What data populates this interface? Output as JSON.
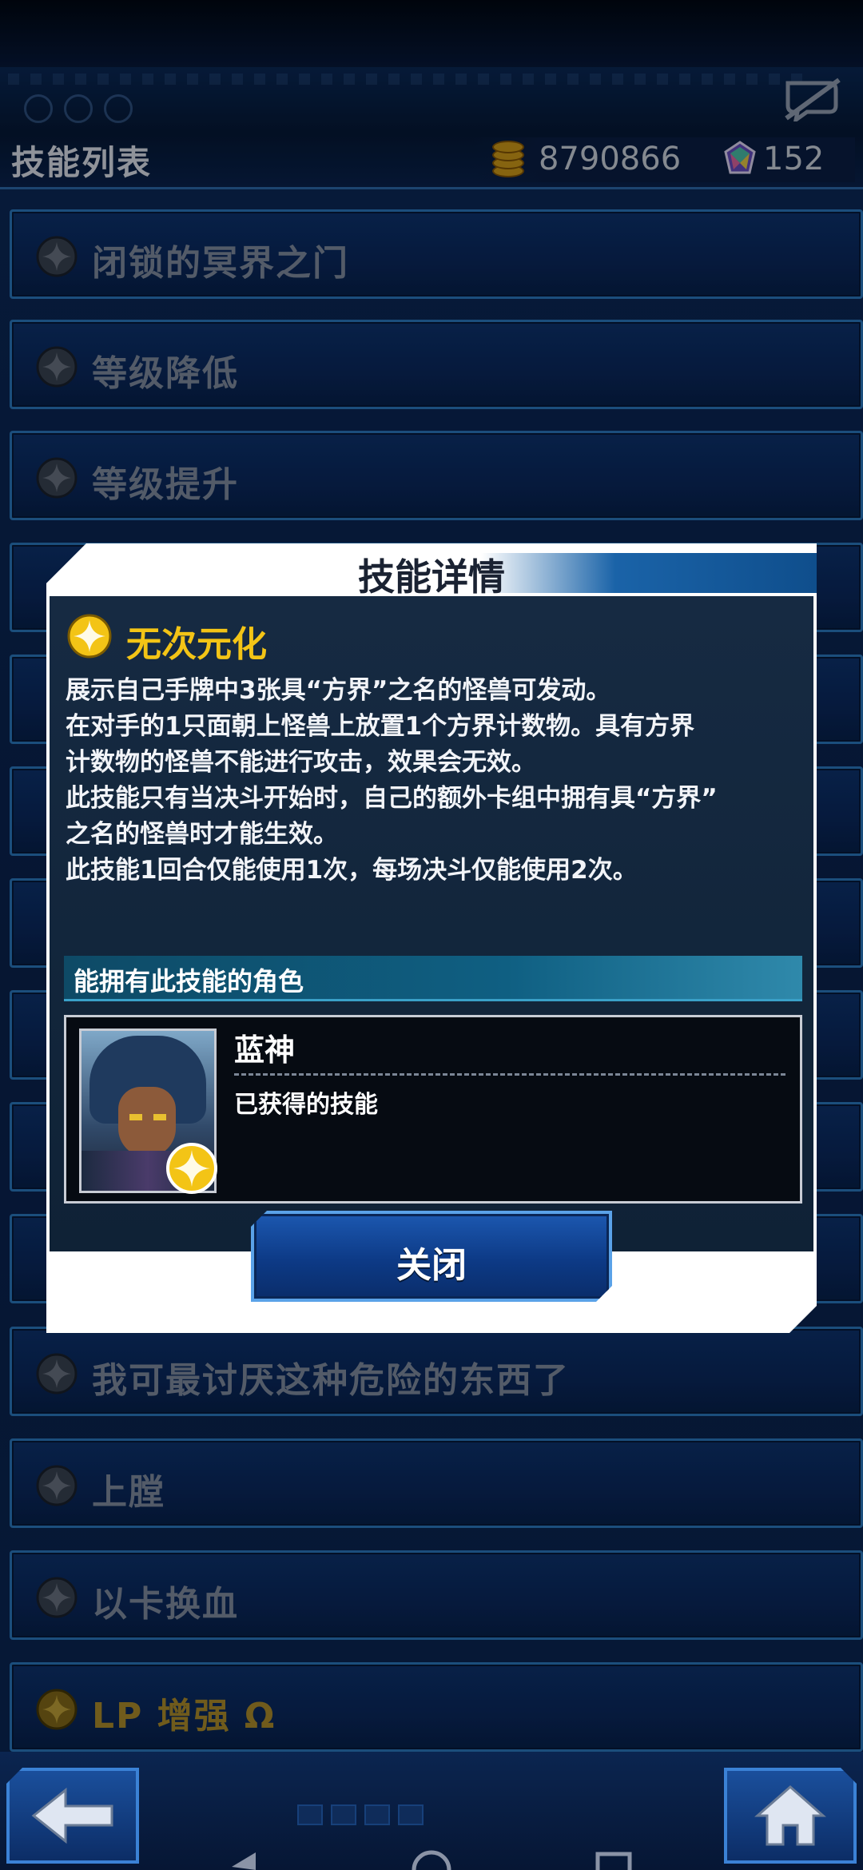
{
  "header": {
    "title": "技能列表",
    "coins": "8790866",
    "gems": "152"
  },
  "skills": [
    {
      "name": "闭锁的冥界之门",
      "badge": "gray"
    },
    {
      "name": "等级降低",
      "badge": "gray"
    },
    {
      "name": "等级提升",
      "badge": "gray"
    },
    {
      "name": "我可最讨厌这种危险的东西了",
      "badge": "gray"
    },
    {
      "name": "上膛",
      "badge": "gray"
    },
    {
      "name": "以卡换血",
      "badge": "gray"
    },
    {
      "name": "LP 增强 Ω",
      "badge": "gold"
    }
  ],
  "modal": {
    "title": "技能详情",
    "skill_name": "无次元化",
    "description": [
      "展示自己手牌中3张具“方界”之名的怪兽可发动。",
      "在对手的1只面朝上怪兽上放置1个方界计数物。具有方界",
      "计数物的怪兽不能进行攻击，效果会无效。",
      "此技能只有当决斗开始时，自己的额外卡组中拥有具“方界”",
      "之名的怪兽时才能生效。",
      "此技能1回合仅能使用1次，每场决斗仅能使用2次。"
    ],
    "section_label": "能拥有此技能的角色",
    "character": {
      "name": "蓝神",
      "status": "已获得的技能"
    },
    "close_label": "关闭"
  },
  "colors": {
    "accent_gold": "#f3c416",
    "frame_blue": "#2c7ec8"
  },
  "icons": {
    "coin": "coin-stack-icon",
    "gem": "rainbow-gem-icon",
    "chat": "chat-muted-icon",
    "back": "arrow-left-icon",
    "home": "home-icon",
    "skill_badge": "sparkle-star-icon"
  }
}
